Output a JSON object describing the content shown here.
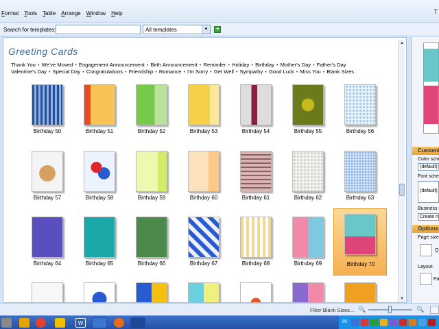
{
  "menu": {
    "items": [
      "Format",
      "Tools",
      "Table",
      "Arrange",
      "Window",
      "Help"
    ],
    "app_letter": "T"
  },
  "search": {
    "label": "Search for templates:",
    "value": "",
    "scope": "All templates"
  },
  "gallery": {
    "title": "Greeting Cards",
    "categories": [
      "Thank You",
      "We've Moved",
      "Engagement Announcement",
      "Birth Announcement",
      "Reminder",
      "Holiday",
      "Birthday",
      "Mother's Day",
      "Father's Day",
      "Valentine's Day",
      "Special Day",
      "Congratulations",
      "Friendship",
      "Romance",
      "I'm Sorry",
      "Get Well",
      "Sympathy",
      "Good Luck",
      "Miss You",
      "Blank Sizes"
    ],
    "separator": "•",
    "cards": [
      {
        "label": "Birthday 50",
        "theme": "blue-stripes"
      },
      {
        "label": "Birthday 51",
        "theme": "orange-red"
      },
      {
        "label": "Birthday 52",
        "theme": "green"
      },
      {
        "label": "Birthday 53",
        "theme": "yellow"
      },
      {
        "label": "Birthday 54",
        "theme": "maroon-plaid"
      },
      {
        "label": "Birthday 55",
        "theme": "olive-star"
      },
      {
        "label": "Birthday 56",
        "theme": "light-blue-dots"
      },
      {
        "label": "Birthday 57",
        "theme": "photo-cake"
      },
      {
        "label": "Birthday 58",
        "theme": "photo-balloons"
      },
      {
        "label": "Birthday 59",
        "theme": "lime"
      },
      {
        "label": "Birthday 60",
        "theme": "peach"
      },
      {
        "label": "Birthday 61",
        "theme": "pink-stripes"
      },
      {
        "label": "Birthday 62",
        "theme": "grey-pattern"
      },
      {
        "label": "Birthday 63",
        "theme": "blue-pattern"
      },
      {
        "label": "Birthday 64",
        "theme": "purple"
      },
      {
        "label": "Birthday 65",
        "theme": "teal"
      },
      {
        "label": "Birthday 66",
        "theme": "green-frame"
      },
      {
        "label": "Birthday 67",
        "theme": "blue-gifts"
      },
      {
        "label": "Birthday 68",
        "theme": "tan-stripes"
      },
      {
        "label": "Birthday 69",
        "theme": "pink-blocks"
      },
      {
        "label": "Birthday 70",
        "theme": "cyan-pink",
        "selected": true
      },
      {
        "label": "",
        "theme": "plain"
      },
      {
        "label": "",
        "theme": "clown"
      },
      {
        "label": "",
        "theme": "yellow-blocks"
      },
      {
        "label": "",
        "theme": "cyan-blocks"
      },
      {
        "label": "",
        "theme": "cartoon"
      },
      {
        "label": "",
        "theme": "purple-pink"
      },
      {
        "label": "",
        "theme": "orange"
      }
    ]
  },
  "right_pane": {
    "customize_header": "Customize",
    "color_scheme_label": "Color scheme:",
    "color_scheme_value": "(default)",
    "font_scheme_label": "Font scheme:",
    "font_scheme_value": "(default)",
    "business_info_label": "Business information:",
    "business_info_button": "Create new...",
    "options_header": "Options",
    "page_size_label": "Page size:",
    "page_size_icon_label": "Q",
    "layout_label": "Layout:",
    "layout_value": "Pa"
  },
  "status": {
    "filter_text": "Filter Blank Sizes..."
  },
  "taskbar": {
    "tray_text": "IN"
  },
  "colors": {
    "accent_orange": "#f5b050",
    "title_blue": "#3b6aa0",
    "taskbar_blue": "#2552a8"
  }
}
